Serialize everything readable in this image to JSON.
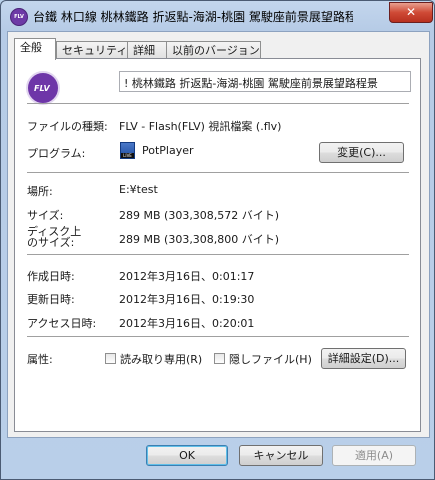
{
  "window": {
    "title": "台鐵 林口線 桃林鐵路 折返點-海湖-桃園 駕駛座前景展望路程...",
    "app_icon_text": "FLV",
    "close_symbol": "✕"
  },
  "tabs": [
    {
      "label": "全般",
      "active": true
    },
    {
      "label": "セキュリティ",
      "active": false
    },
    {
      "label": "詳細",
      "active": false
    },
    {
      "label": "以前のバージョン",
      "active": false
    }
  ],
  "general": {
    "file_icon": "flv-file-icon",
    "file_icon_text": "FLV",
    "filename": "! 桃林鐵路 折返點-海湖-桃園 駕駛座前景展望路程景",
    "file_type_label": "ファイルの種類:",
    "file_type_value": "FLV - Flash(FLV) 視訊檔案 (.flv)",
    "program_label": "プログラム:",
    "program_icon": "potplayer-icon",
    "program_icon_text": "LIVE",
    "program_value": "PotPlayer",
    "change_button": "変更(C)...",
    "location_label": "場所:",
    "location_value": "E:¥test",
    "size_label": "サイズ:",
    "size_value": "289 MB (303,308,572 バイト)",
    "disk_size_label_1": "ディスク上",
    "disk_size_label_2": "のサイズ:",
    "disk_size_value": "289 MB (303,308,800 バイト)",
    "created_label": "作成日時:",
    "created_value": "2012年3月16日、0:01:17",
    "modified_label": "更新日時:",
    "modified_value": "2012年3月16日、0:19:30",
    "accessed_label": "アクセス日時:",
    "accessed_value": "2012年3月16日、0:20:01",
    "attributes_label": "属性:",
    "readonly_label": "読み取り専用(R)",
    "readonly_checked": false,
    "hidden_label": "隠しファイル(H)",
    "hidden_checked": false,
    "advanced_button": "詳細設定(D)..."
  },
  "footer": {
    "ok_button": "OK",
    "cancel_button": "キャンセル",
    "apply_button": "適用(A)"
  }
}
